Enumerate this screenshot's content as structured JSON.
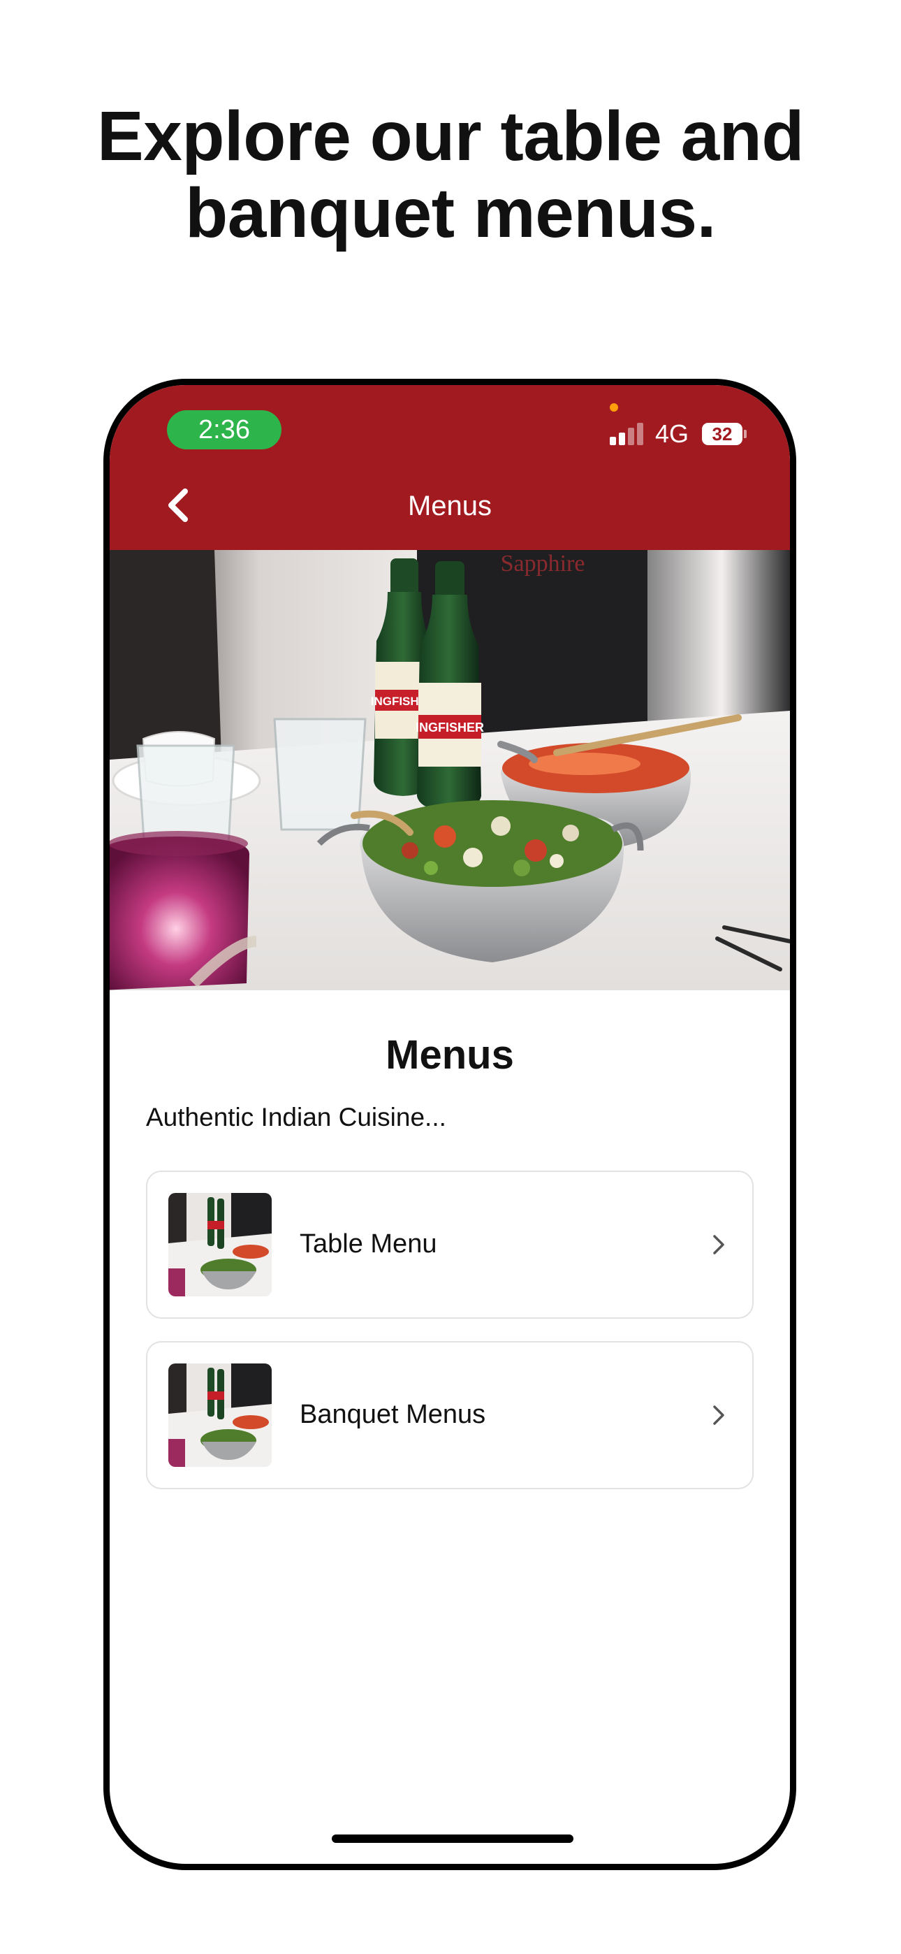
{
  "headline": {
    "line1": "Explore our table and",
    "line2": "banquet menus."
  },
  "status_bar": {
    "time": "2:36",
    "network": "4G",
    "battery": "32"
  },
  "nav": {
    "title": "Menus"
  },
  "hero": {
    "sign_text": "Sapphire",
    "bottle_label": "INGFISHER"
  },
  "main": {
    "title": "Menus",
    "tagline": "Authentic Indian Cuisine..."
  },
  "menu_items": [
    {
      "label": "Table Menu"
    },
    {
      "label": "Banquet Menus"
    }
  ],
  "colors": {
    "brand_red": "#a11a20",
    "time_pill_green": "#2db44a"
  },
  "icons": [
    "back-chevron-icon",
    "signal-icon",
    "battery-icon",
    "chevron-right-icon"
  ]
}
